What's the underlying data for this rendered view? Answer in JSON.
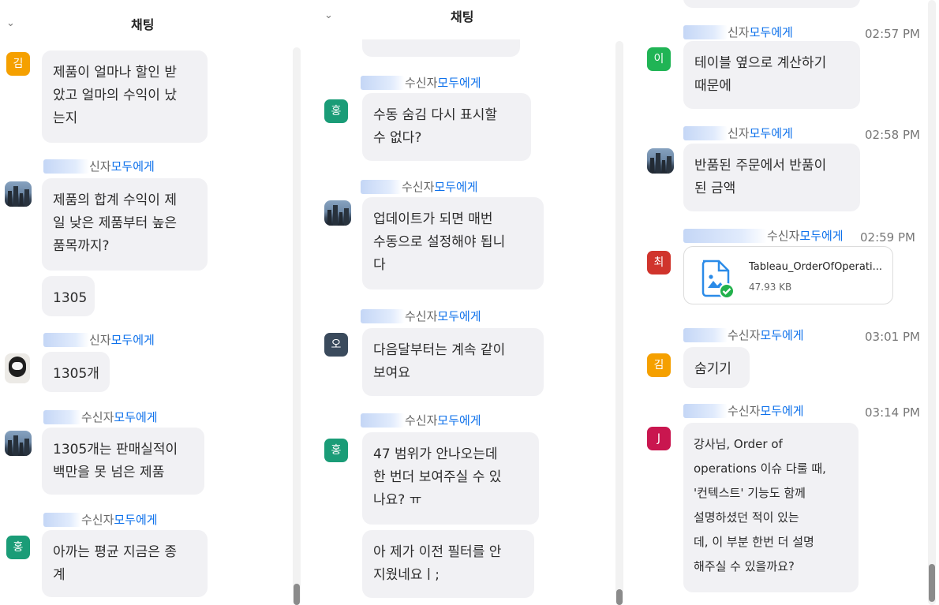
{
  "header": {
    "title": "채팅"
  },
  "labels": {
    "recipient_prefix": "수신자",
    "everyone": "모두에게",
    "partial_prefix": "신자"
  },
  "panel1": {
    "messages": [
      {
        "avatar": "김",
        "text": "제품이 얼마나 할인 받\n았고 얼마의 수익이 났\n는지"
      },
      {
        "text": "제품의 합계 수익이 제\n일 낮은 제품부터 높은\n품목까지?"
      },
      {
        "text": "1305"
      },
      {
        "text": "1305개"
      },
      {
        "text": "1305개는 판매실적이\n백만을 못 넘은 제품"
      },
      {
        "avatar": "홍",
        "text": "아까는 평균 지금은 종\n계"
      }
    ]
  },
  "panel2": {
    "messages": [
      {
        "avatar": "홍",
        "text": "수동 숨김 다시 표시할\n수 없다?"
      },
      {
        "text": "업데이트가 되면 매번\n수동으로 설정해야 됩니\n다"
      },
      {
        "avatar": "오",
        "text": "다음달부터는 계속 같이\n보여요"
      },
      {
        "avatar": "홍",
        "text": "47 범위가 안나오는데\n한 번더 보여주실 수 있\n나요? ㅠ"
      },
      {
        "text": "아 제가 이전 필터를 안\n지웠네요ㅣ;"
      }
    ]
  },
  "panel3": {
    "messages": [
      {
        "time": "02:57 PM",
        "avatar": "이",
        "text": "테이블 옆으로 계산하기\n때문에"
      },
      {
        "time": "02:58 PM",
        "text": "반품된 주문에서 반품이\n된 금액"
      },
      {
        "time": "02:59 PM",
        "avatar": "최",
        "file_name": "Tableau_OrderOfOperati...",
        "file_size": "47.93 KB"
      },
      {
        "time": "03:01 PM",
        "avatar": "김",
        "text": "숨기기"
      },
      {
        "time": "03:14 PM",
        "avatar": "J",
        "text": "강사님, Order of\noperations 이슈 다룰 때,\n'컨텍스트' 기능도 함께\n설명하셨던 적이 있는\n데, 이 부분 한번 더 설명\n해주실 수 있을까요?"
      }
    ]
  },
  "colors": {
    "kim": "#f5a000",
    "hong": "#1a9c77",
    "oh": "#3a4a5c",
    "lee": "#20b455",
    "choi": "#d0342c",
    "j": "#c9164f",
    "link": "#0e71eb",
    "bubble": "#f1f1f4"
  }
}
